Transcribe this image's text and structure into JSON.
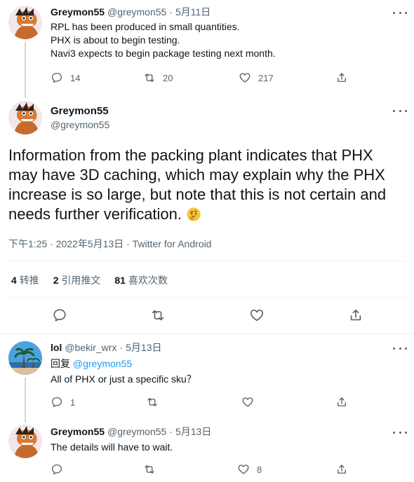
{
  "tweet1": {
    "name": "Greymon55",
    "handle": "@greymon55",
    "sep": "·",
    "date": "5月11日",
    "lines": [
      "RPL has been produced in small quantities.",
      "PHX is about to begin testing.",
      "Navi3 expects to begin package testing next month."
    ],
    "replies": "14",
    "retweets": "20",
    "likes": "217"
  },
  "main": {
    "name": "Greymon55",
    "handle": "@greymon55",
    "text": "Information from the packing plant indicates that PHX may have 3D caching, which may explain why the PHX increase is so large, but note that this is not certain and needs further verification.",
    "emoji": "thinking-face-icon",
    "meta": "下午1:25 · 2022年5月13日 · Twitter for Android",
    "stats": {
      "retweets_count": "4",
      "retweets_label": "转推",
      "quotes_count": "2",
      "quotes_label": "引用推文",
      "likes_count": "81",
      "likes_label": "喜欢次数"
    }
  },
  "reply1": {
    "name": "lol",
    "handle": "@bekir_wrx",
    "sep": "·",
    "date": "5月13日",
    "reply_to_prefix": "回复",
    "reply_to_handle": "@greymon55",
    "text": "All of PHX or just a specific sku？",
    "replies": "1"
  },
  "reply2": {
    "name": "Greymon55",
    "handle": "@greymon55",
    "sep": "·",
    "date": "5月13日",
    "text": "The details will have to wait.",
    "likes": "8"
  },
  "colors": {
    "text": "#0f1419",
    "muted": "#536471",
    "link": "#1d9bf0",
    "divider": "#eff3f4"
  }
}
